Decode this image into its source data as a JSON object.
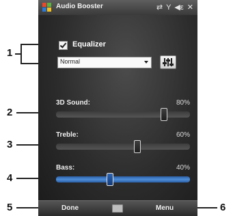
{
  "window": {
    "title": "Audio Booster",
    "status_icons": [
      "connectivity-icon",
      "signal-icon",
      "volume-icon",
      "close-icon"
    ]
  },
  "equalizer": {
    "label": "Equalizer",
    "enabled": true,
    "preset": "Normal"
  },
  "sliders": [
    {
      "label": "3D Sound:",
      "value_text": "80%",
      "value": 0.8,
      "active": false
    },
    {
      "label": "Treble:",
      "value_text": "60%",
      "value": 0.6,
      "active": false
    },
    {
      "label": "Bass:",
      "value_text": "40%",
      "value": 0.4,
      "active": true
    }
  ],
  "menubar": {
    "left_softkey": "Done",
    "right_softkey": "Menu"
  },
  "callouts": [
    "1",
    "2",
    "3",
    "4",
    "5",
    "6"
  ],
  "colors": {
    "screen_bg": "#2c2c2c",
    "active_track": "#4f8fd8"
  }
}
